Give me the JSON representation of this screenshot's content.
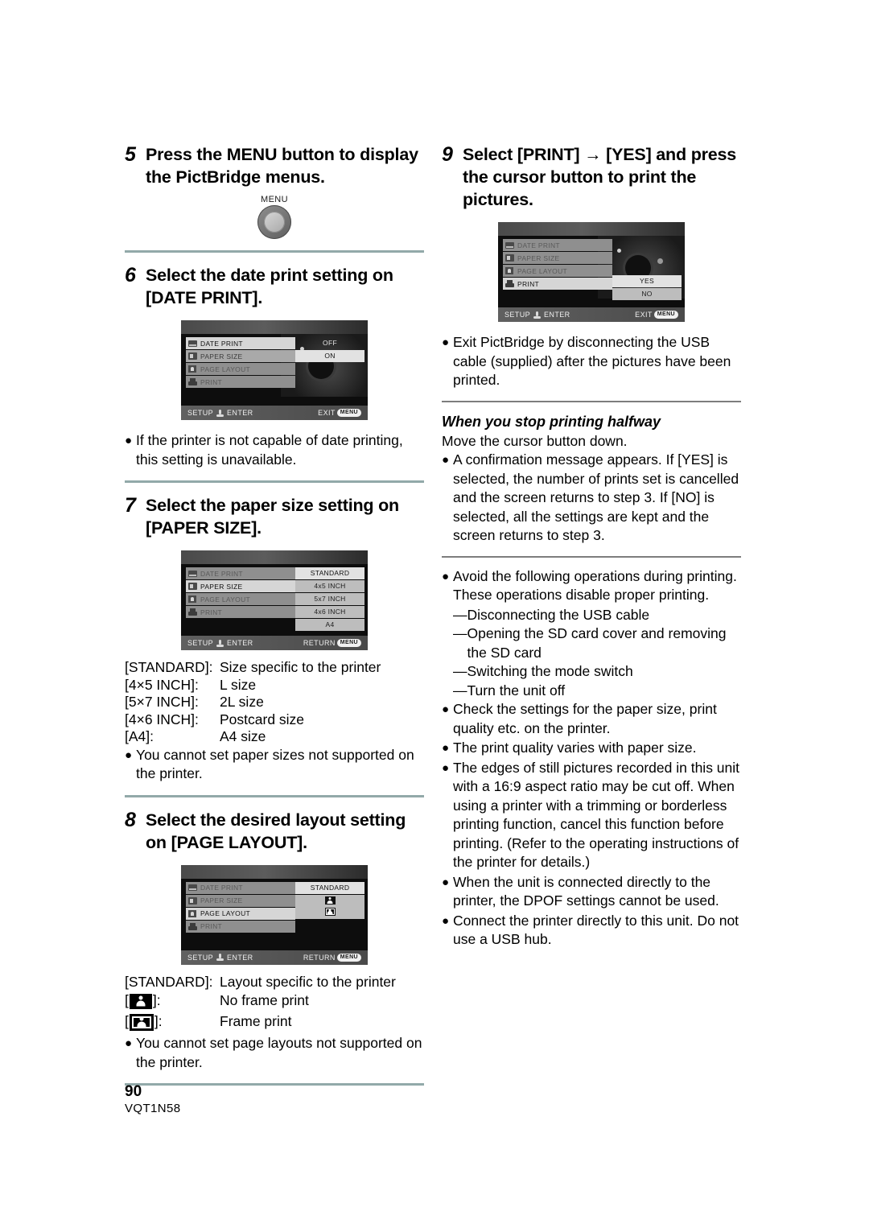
{
  "document": {
    "page_number": "90",
    "doc_code": "VQT1N58"
  },
  "left_column": {
    "step5": {
      "number": "5",
      "title": "Press the MENU button to display the PictBridge menus.",
      "button_label": "MENU"
    },
    "step6": {
      "number": "6",
      "title": "Select the date print setting on [DATE PRINT].",
      "screen": {
        "rows": [
          {
            "label": "DATE PRINT",
            "state": "active",
            "icon": "date-icon"
          },
          {
            "label": "PAPER SIZE",
            "state": "normal",
            "icon": "paper-icon"
          },
          {
            "label": "PAGE LAYOUT",
            "state": "dim",
            "icon": "layout-icon"
          },
          {
            "label": "PRINT",
            "state": "dim",
            "icon": "printer-icon"
          }
        ],
        "values": [
          {
            "text": "OFF",
            "state": "plain"
          },
          {
            "text": "ON",
            "state": "hl"
          }
        ],
        "bottom_left": "SETUP",
        "bottom_enter": "ENTER",
        "bottom_right": "EXIT",
        "bottom_badge": "MENU"
      },
      "notes": [
        "If the printer is not capable of date printing, this setting is unavailable."
      ]
    },
    "step7": {
      "number": "7",
      "title": "Select the paper size setting on [PAPER SIZE].",
      "screen": {
        "rows": [
          {
            "label": "DATE PRINT",
            "state": "dim",
            "icon": "date-icon"
          },
          {
            "label": "PAPER SIZE",
            "state": "active",
            "icon": "paper-icon"
          },
          {
            "label": "PAGE LAYOUT",
            "state": "dim",
            "icon": "layout-icon"
          },
          {
            "label": "PRINT",
            "state": "dim",
            "icon": "printer-icon"
          }
        ],
        "values": [
          {
            "text": "STANDARD",
            "state": "hl"
          },
          {
            "text": "4x5 INCH",
            "state": "opt"
          },
          {
            "text": "5x7 INCH",
            "state": "opt"
          },
          {
            "text": "4x6 INCH",
            "state": "opt"
          },
          {
            "text": "A4",
            "state": "opt"
          }
        ],
        "bottom_left": "SETUP",
        "bottom_enter": "ENTER",
        "bottom_right": "RETURN",
        "bottom_badge": "MENU"
      },
      "legend": [
        {
          "key": "[STANDARD]:",
          "value": "Size specific to the printer"
        },
        {
          "key": "[4×5 INCH]:",
          "value": "L size"
        },
        {
          "key": "[5×7 INCH]:",
          "value": "2L size"
        },
        {
          "key": "[4×6 INCH]:",
          "value": "Postcard size"
        },
        {
          "key": "[A4]:",
          "value": "A4 size"
        }
      ],
      "notes": [
        "You cannot set paper sizes not supported on the printer."
      ]
    },
    "step8": {
      "number": "8",
      "title": "Select the desired layout setting on [PAGE LAYOUT].",
      "screen": {
        "rows": [
          {
            "label": "DATE PRINT",
            "state": "dim",
            "icon": "date-icon"
          },
          {
            "label": "PAPER SIZE",
            "state": "dim",
            "icon": "paper-icon"
          },
          {
            "label": "PAGE LAYOUT",
            "state": "active",
            "icon": "layout-icon"
          },
          {
            "label": "PRINT",
            "state": "dim",
            "icon": "printer-icon"
          }
        ],
        "values": [
          {
            "text": "STANDARD",
            "state": "hl"
          }
        ],
        "icon_options": [
          "page-layout-noframe-icon",
          "page-layout-frame-icon"
        ],
        "bottom_left": "SETUP",
        "bottom_enter": "ENTER",
        "bottom_right": "RETURN",
        "bottom_badge": "MENU"
      },
      "legend_standard": {
        "key": "[STANDARD]:",
        "value": "Layout specific to the printer"
      },
      "legend_icons": [
        {
          "icon": "page-layout-noframe-icon",
          "value": "No frame print"
        },
        {
          "icon": "page-layout-frame-icon",
          "value": "Frame print"
        }
      ],
      "notes": [
        "You cannot set page layouts not supported on the printer."
      ]
    }
  },
  "right_column": {
    "step9": {
      "number": "9",
      "title": "Select [PRINT] → [YES] and press the cursor button to print the pictures.",
      "screen": {
        "rows": [
          {
            "label": "DATE PRINT",
            "state": "dim",
            "icon": "date-icon"
          },
          {
            "label": "PAPER SIZE",
            "state": "dim",
            "icon": "paper-icon"
          },
          {
            "label": "PAGE LAYOUT",
            "state": "dim",
            "icon": "layout-icon"
          },
          {
            "label": "PRINT",
            "state": "active",
            "icon": "printer-icon"
          }
        ],
        "values": [
          {
            "text": "YES",
            "state": "hl"
          },
          {
            "text": "NO",
            "state": "opt"
          }
        ],
        "bottom_left": "SETUP",
        "bottom_enter": "ENTER",
        "bottom_right": "EXIT",
        "bottom_badge": "MENU"
      },
      "notes": [
        "Exit PictBridge by disconnecting the USB cable (supplied) after the pictures have been printed."
      ]
    },
    "stop_printing": {
      "heading": "When you stop printing halfway",
      "instruction": "Move the cursor button down.",
      "notes": [
        "A confirmation message appears. If [YES] is selected, the number of prints set is cancelled and the screen returns to step 3. If [NO] is selected, all the settings are kept and the screen returns to step 3."
      ]
    },
    "cautions": {
      "avoid_intro": "Avoid the following operations during printing. These operations disable proper printing.",
      "avoid_items": [
        "Disconnecting the USB cable",
        "Opening the SD card cover and removing the SD card",
        "Switching the mode switch",
        "Turn the unit off"
      ],
      "notes": [
        "Check the settings for the paper size, print quality etc. on the printer.",
        "The print quality varies with paper size.",
        "The edges of still pictures recorded in this unit with a 16:9 aspect ratio may be cut off. When using a printer with a trimming or borderless printing function, cancel this function before printing. (Refer to the operating instructions of the printer for details.)",
        "When the unit is connected directly to the printer, the DPOF settings cannot be used.",
        "Connect the printer directly to this unit. Do not use a USB hub."
      ]
    }
  },
  "symbols": {
    "bullet": "●",
    "dash": "—"
  },
  "colors": {
    "rule_teal": "#92a9a9",
    "rule_gray": "#7d7d7d",
    "lcd_bg": "#0d0d0d"
  }
}
